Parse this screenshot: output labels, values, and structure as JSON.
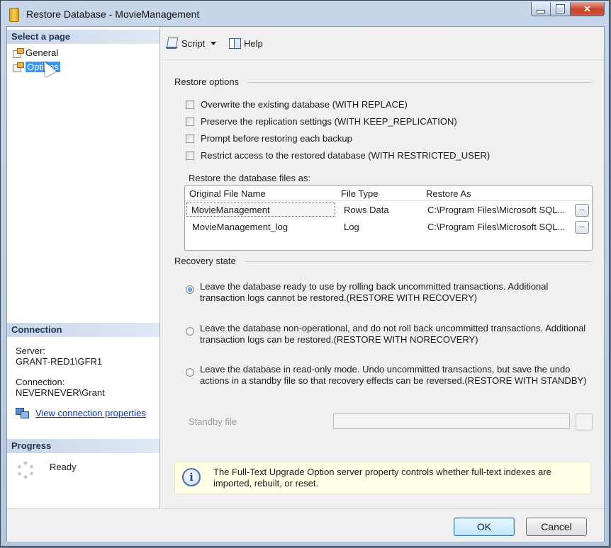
{
  "window": {
    "title": "Restore Database - MovieManagement"
  },
  "select_page": {
    "heading": "Select a page",
    "items": [
      {
        "label": "General"
      },
      {
        "label": "Options"
      }
    ]
  },
  "connection": {
    "heading": "Connection",
    "server_label": "Server:",
    "server_value": "GRANT-RED1\\GFR1",
    "connection_label": "Connection:",
    "connection_value": "NEVERNEVER\\Grant",
    "view_link": "View connection properties"
  },
  "progress": {
    "heading": "Progress",
    "status": "Ready"
  },
  "toolbar": {
    "script_label": "Script",
    "help_label": "Help"
  },
  "restore_options": {
    "heading": "Restore options",
    "checkboxes": [
      {
        "label": "Overwrite the existing database (WITH REPLACE)",
        "checked": false
      },
      {
        "label": "Preserve the replication settings (WITH KEEP_REPLICATION)",
        "checked": false
      },
      {
        "label": "Prompt before restoring each backup",
        "checked": false
      },
      {
        "label": "Restrict access to the restored database (WITH RESTRICTED_USER)",
        "checked": false
      }
    ],
    "files_label": "Restore the database files as:",
    "columns": [
      "Original File Name",
      "File Type",
      "Restore As"
    ],
    "rows": [
      {
        "name": "MovieManagement",
        "type": "Rows Data",
        "restore_as": "C:\\Program Files\\Microsoft SQL...",
        "button": "..."
      },
      {
        "name": "MovieManagement_log",
        "type": "Log",
        "restore_as": "C:\\Program Files\\Microsoft SQL...",
        "button": "..."
      }
    ]
  },
  "recovery_state": {
    "heading": "Recovery state",
    "options": [
      {
        "text": "Leave the database ready to use by rolling back uncommitted transactions. Additional transaction logs cannot be restored.(RESTORE WITH RECOVERY)",
        "selected": true
      },
      {
        "text": "Leave the database non-operational, and do not roll back uncommitted transactions. Additional transaction logs can be restored.(RESTORE WITH NORECOVERY)",
        "selected": false
      },
      {
        "text": "Leave the database in read-only mode. Undo uncommitted transactions, but save the undo actions in a standby file so that recovery effects can be reversed.(RESTORE WITH STANDBY)",
        "selected": false
      }
    ],
    "standby_label": "Standby file",
    "standby_value": ""
  },
  "info": {
    "text": "The Full-Text Upgrade Option server property controls whether full-text indexes are imported, rebuilt, or reset."
  },
  "buttons": {
    "ok": "OK",
    "cancel": "Cancel"
  }
}
